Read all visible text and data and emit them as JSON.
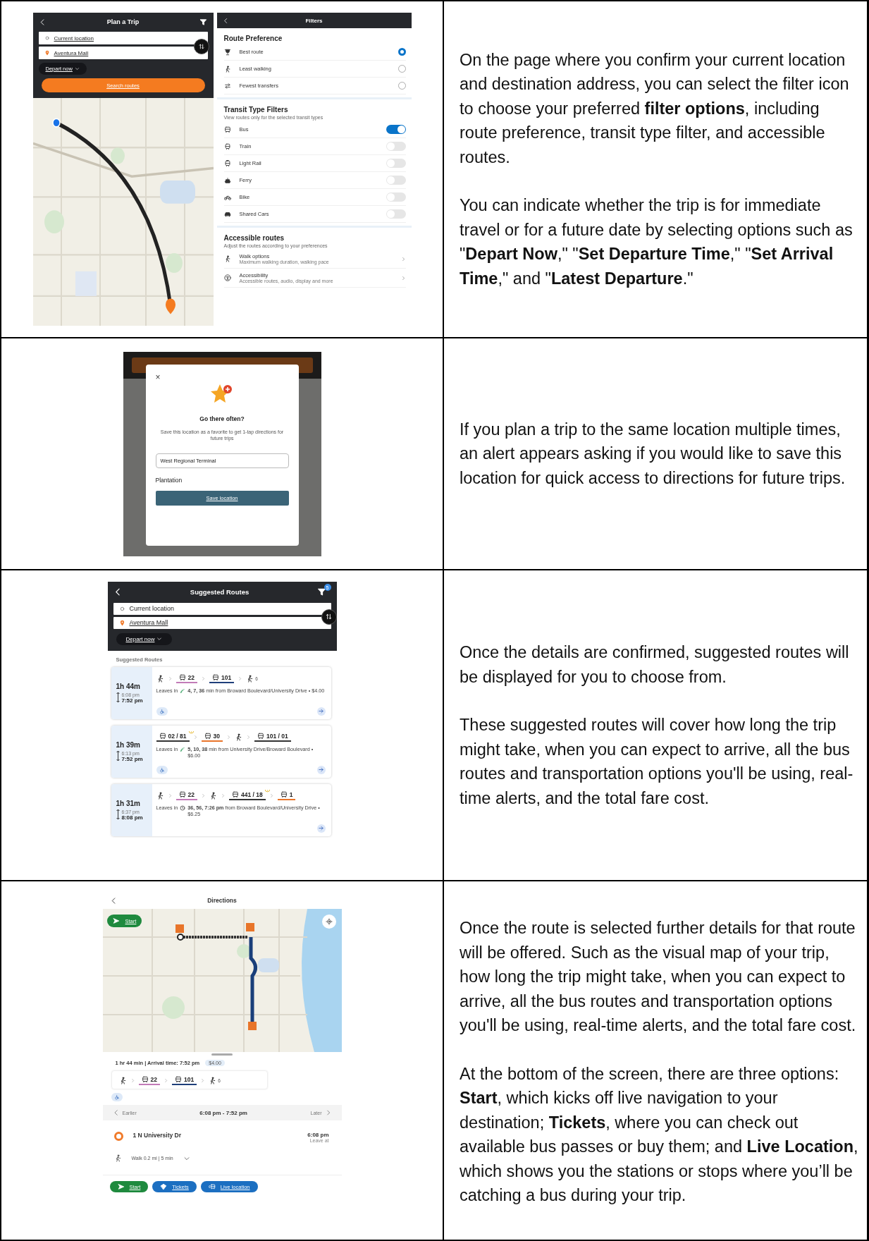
{
  "step_1": {
    "plan_trip": {
      "title": "Plan a Trip",
      "origin": "Current location",
      "destination": "Aventura Mall",
      "departure": "Depart now",
      "search_button": "Search routes"
    },
    "filters": {
      "title": "Filters",
      "route_preference": {
        "heading": "Route Preference",
        "options": [
          {
            "kind": "trophy",
            "label": "Best route",
            "selected": true
          },
          {
            "kind": "walk",
            "label": "Least walking",
            "selected": false
          },
          {
            "kind": "transfer",
            "label": "Fewest transfers",
            "selected": false
          }
        ]
      },
      "transit_types": {
        "heading": "Transit Type Filters",
        "subtitle": "View routes only for the selected transit types",
        "items": [
          {
            "kind": "bus",
            "label": "Bus",
            "on": true
          },
          {
            "kind": "train",
            "label": "Train",
            "on": false
          },
          {
            "kind": "tram",
            "label": "Light Rail",
            "on": false
          },
          {
            "kind": "ferry",
            "label": "Ferry",
            "on": false
          },
          {
            "kind": "bike",
            "label": "Bike",
            "on": false
          },
          {
            "kind": "car",
            "label": "Shared Cars",
            "on": false
          }
        ]
      },
      "accessible_routes": {
        "heading": "Accessible routes",
        "subtitle": "Adjust the routes according to your preferences",
        "items": [
          {
            "kind": "walk",
            "title": "Walk options",
            "subtitle": "Maximum walking duration, walking pace"
          },
          {
            "kind": "accessibility",
            "title": "Accessibility",
            "subtitle": "Accessible routes, audio, display and more"
          }
        ]
      }
    },
    "description": [
      "On the page where you confirm your current location and destination address, you can select the filter icon to choose your preferred **filter options**, including route preference, transit type filter, and accessible routes.",
      "You can indicate whether the trip is for immediate travel or for a future date by selecting options such as \"**Depart Now**,\" \"**Set Departure Time**,\" \"**Set Arrival Time**,\" and \"**Latest Departure**.\""
    ]
  },
  "step_2": {
    "favorite_dialog": {
      "close": "×",
      "title": "Go there often?",
      "message": "Save this location as a favorite to get 1-tap directions for future trips",
      "name_field": "West Regional Terminal",
      "location": "Plantation",
      "save_button": "Save location"
    },
    "description": [
      "If you plan a trip to the same location multiple times, an alert appears asking if you would like to save this location for quick access to directions for future trips."
    ]
  },
  "step_3": {
    "suggested_routes": {
      "title": "Suggested Routes",
      "filter_badge": "5",
      "origin": "Current location",
      "destination": "Aventura Mall",
      "departure": "Depart now",
      "section_label": "Suggested Routes",
      "routes": [
        {
          "duration": "1h 44m",
          "depart_time": "6:08 pm",
          "arrive_time": "7:52 pm",
          "legs": [
            {
              "kind": "walk"
            },
            {
              "kind": "bus",
              "label": "22",
              "color": "#c27bb8",
              "alert": false
            },
            {
              "kind": "bus",
              "label": "101",
              "color": "#1f3f7a",
              "alert": false
            },
            {
              "kind": "walk",
              "label": "6"
            }
          ],
          "departs": {
            "kind": "realtime",
            "prefix": "Leaves in",
            "details": "**4, 7, 36** min from Broward Boulevard/University Drive • $4.00"
          },
          "accessible": true
        },
        {
          "duration": "1h 39m",
          "depart_time": "6:13 pm",
          "arrive_time": "7:52 pm",
          "legs": [
            {
              "kind": "bus",
              "label": "02 / 81",
              "color": "#333333",
              "alert": true
            },
            {
              "kind": "bus",
              "label": "30",
              "color": "#e8752a",
              "alert": false
            },
            {
              "kind": "walk"
            },
            {
              "kind": "bus",
              "label": "101 / 01",
              "color": "#333333",
              "alert": false
            }
          ],
          "departs": {
            "kind": "realtime",
            "prefix": "Leaves in",
            "details": "**5, 10, 38** min from University Drive/Broward Boulevard • $6.00"
          },
          "accessible": true
        },
        {
          "duration": "1h 31m",
          "depart_time": "6:37 pm",
          "arrive_time": "8:08 pm",
          "legs": [
            {
              "kind": "walk"
            },
            {
              "kind": "bus",
              "label": "22",
              "color": "#c27bb8",
              "alert": false
            },
            {
              "kind": "walk"
            },
            {
              "kind": "bus",
              "label": "441 / 18",
              "color": "#333333",
              "alert": true
            },
            {
              "kind": "bus",
              "label": "1",
              "color": "#e8752a",
              "alert": false
            }
          ],
          "departs": {
            "kind": "scheduled",
            "prefix": "Leaves in",
            "details": "**36, 56, 7:26 pm** from Broward Boulevard/University Drive • $6.25"
          },
          "accessible": false
        }
      ]
    },
    "description": [
      "Once the details are confirmed, suggested routes will be displayed for you to choose from.",
      "These suggested routes will cover how long the trip might take, when you can expect to arrive, all the bus routes and transportation options you'll be using, real-time alerts, and the total fare cost."
    ]
  },
  "step_4": {
    "directions": {
      "title": "Directions",
      "map_start_button": "Start",
      "summary": "1 hr 44 min | Arrival time: 7:52 pm",
      "fare": "$4.00",
      "legs": [
        {
          "kind": "walk"
        },
        {
          "kind": "bus",
          "label": "22",
          "color": "#c27bb8",
          "alert": false
        },
        {
          "kind": "bus",
          "label": "101",
          "color": "#1f3f7a",
          "alert": false
        },
        {
          "kind": "walk",
          "label": "6"
        }
      ],
      "accessible": true,
      "earlier": "Earlier",
      "time_window": "6:08 pm - 7:52 pm",
      "later": "Later",
      "stop": {
        "name": "1 N University Dr",
        "time": "6:08 pm",
        "note": "Leave at"
      },
      "walk": "Walk 0.2 mi | 5 min",
      "actions": [
        {
          "kind": "start",
          "label": "Start"
        },
        {
          "kind": "tickets",
          "label": "Tickets"
        },
        {
          "kind": "live",
          "label": "Live location"
        }
      ]
    },
    "description": [
      "Once the route is selected further details for that route will be offered. Such as the visual map of your trip, how long the trip might take, when you can expect to arrive, all the bus routes and transportation options you'll be using, real-time alerts, and the total fare cost.",
      "At the bottom of the screen, there are three options: **Start**, which kicks off live navigation to your destination; **Tickets**, where you can check out available bus passes or buy them; and **Live Location**, which shows you the stations or stops where you’ll be catching a bus during your trip."
    ]
  }
}
